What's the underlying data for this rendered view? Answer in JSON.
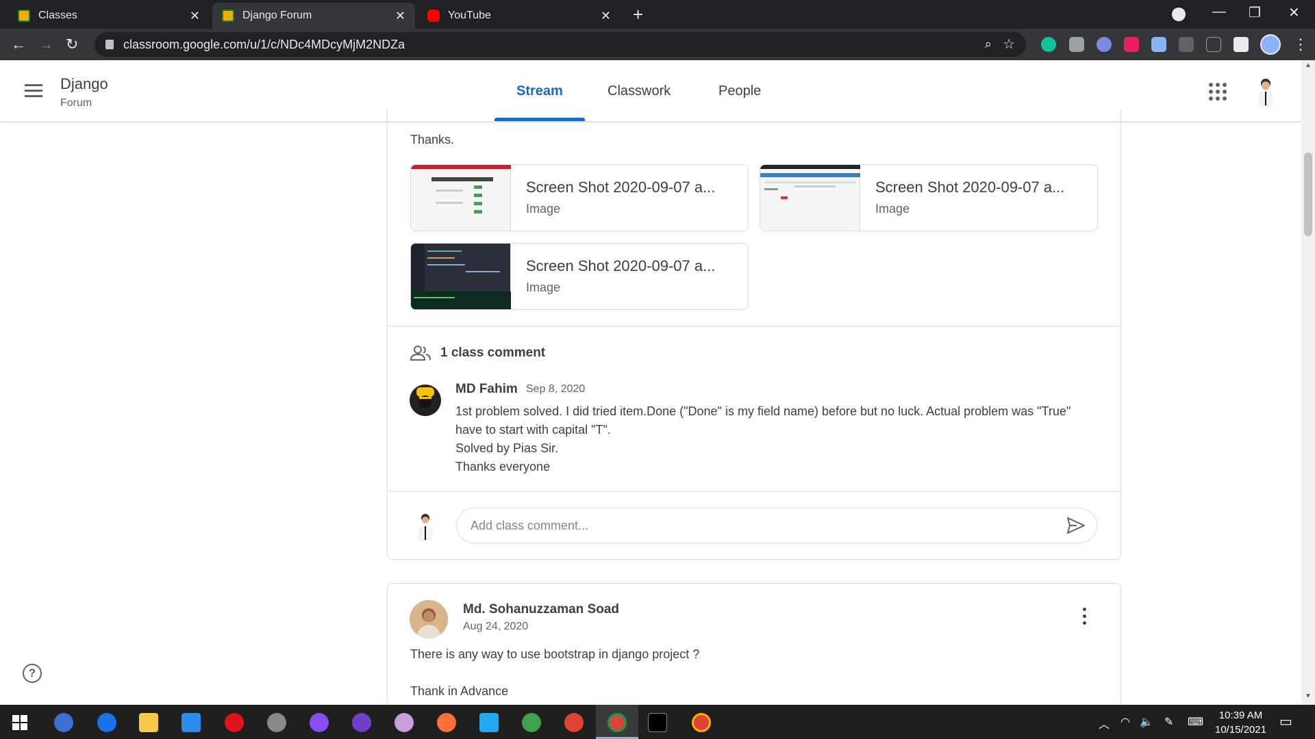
{
  "browser": {
    "tabs": [
      {
        "title": "Classes",
        "icon": "classroom-icon"
      },
      {
        "title": "Django Forum",
        "icon": "classroom-icon",
        "active": true
      },
      {
        "title": "YouTube",
        "icon": "youtube-icon"
      }
    ],
    "url": "classroom.google.com/u/1/c/NDc4MDcyMjM2NDZa"
  },
  "classroom": {
    "title": "Django",
    "section": "Forum",
    "tabs": [
      "Stream",
      "Classwork",
      "People"
    ],
    "active_tab": "Stream"
  },
  "post1": {
    "text_tail": "Thanks.",
    "attachments": [
      {
        "name": "Screen Shot 2020-09-07 a...",
        "type": "Image"
      },
      {
        "name": "Screen Shot 2020-09-07 a...",
        "type": "Image"
      },
      {
        "name": "Screen Shot 2020-09-07 a...",
        "type": "Image"
      }
    ],
    "comment_count_label": "1 class comment",
    "comment": {
      "author": "MD Fahim",
      "date": "Sep 8, 2020",
      "lines": [
        "1st problem solved. I did tried item.Done (\"Done\" is my field name) before but no luck. Actual problem was \"True\" have to start with capital \"T\".",
        "Solved by Pias Sir.",
        "Thanks everyone"
      ]
    },
    "add_comment_placeholder": "Add class comment..."
  },
  "post2": {
    "author": "Md. Sohanuzzaman Soad",
    "date": "Aug 24, 2020",
    "lines": [
      "There is any way to use bootstrap in django project ?",
      "",
      "Thank in Advance"
    ]
  },
  "taskbar": {
    "time": "10:39 AM",
    "date": "10/15/2021"
  },
  "colors": {
    "accent": "#1967d2",
    "text": "#3c4043",
    "border": "#dadce0"
  }
}
